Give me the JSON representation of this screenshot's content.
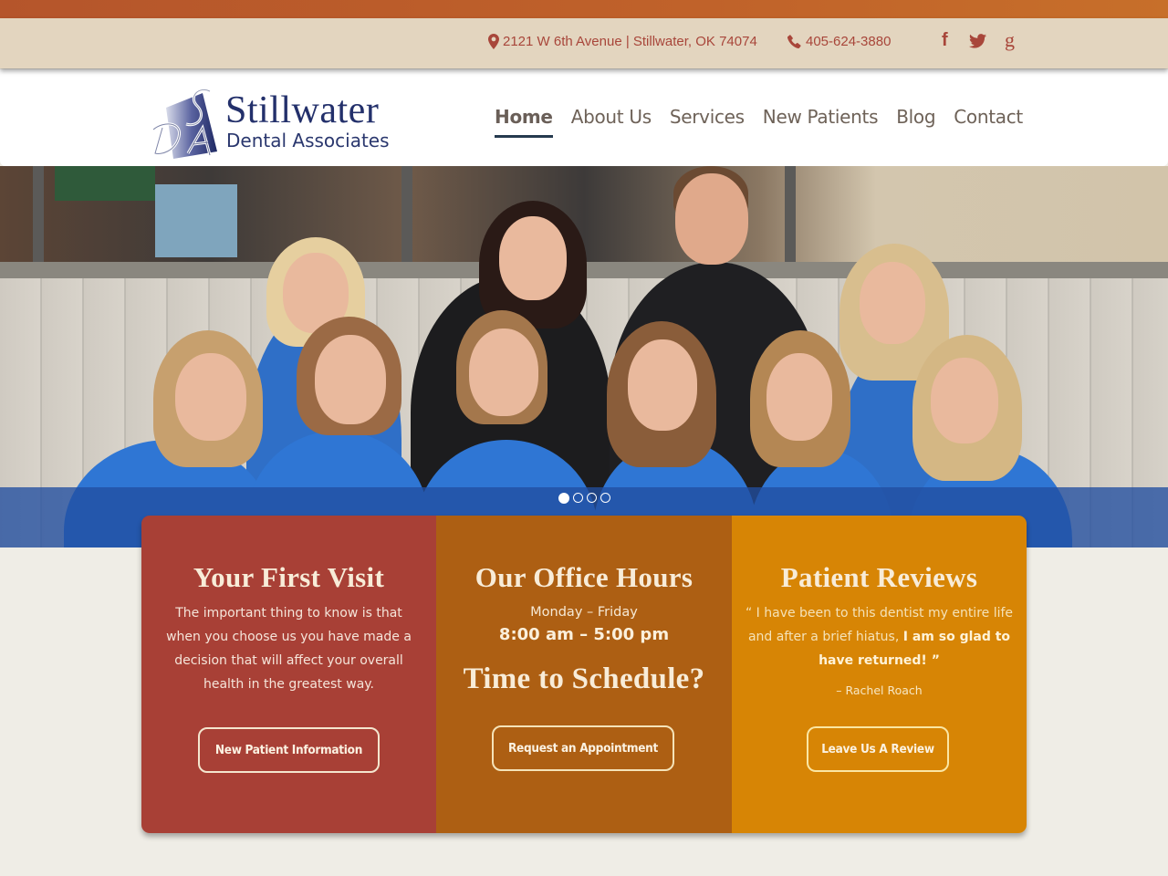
{
  "topbar": {
    "address": "2121 W 6th Avenue | Stillwater, OK 74074",
    "phone": "405-624-3880",
    "address_icon": "map-marker-icon",
    "phone_icon": "phone-icon",
    "social": [
      {
        "name": "facebook-icon",
        "glyph": "f"
      },
      {
        "name": "twitter-icon",
        "glyph": "🐦"
      },
      {
        "name": "google-plus-icon",
        "glyph": "g"
      }
    ]
  },
  "logo": {
    "line1": "Stillwater",
    "line2": "Dental Associates",
    "monogram": "SDA"
  },
  "nav": {
    "items": [
      {
        "label": "Home",
        "active": true
      },
      {
        "label": "About Us"
      },
      {
        "label": "Services"
      },
      {
        "label": "New Patients"
      },
      {
        "label": "Blog"
      },
      {
        "label": "Contact"
      }
    ]
  },
  "hero": {
    "slide_count": 4,
    "active_slide": 1,
    "image_alt": "Stillwater Dental Associates team photo"
  },
  "cards": {
    "first_visit": {
      "title": "Your First Visit",
      "body": "The important thing to know is that when you choose us you have made a decision that will affect your overall health in the greatest way.",
      "button": "New Patient Information"
    },
    "office_hours": {
      "title": "Our Office Hours",
      "days": "Monday – Friday",
      "hours": "8:00 am – 5:00 pm",
      "subtitle": "Time to Schedule?",
      "button": "Request an Appointment"
    },
    "reviews": {
      "title": "Patient Reviews",
      "quote_open": "“ I have been to this dentist my entire life and after a brief hiatus, ",
      "quote_bold": "I am so glad to have returned! ”",
      "author": "– Rachel Roach",
      "button": "Leave Us A Review"
    }
  },
  "colors": {
    "top_strip": "#b5552b",
    "info_bar": "#e3d5bf",
    "accent_text": "#a8463a",
    "logo_navy": "#23306b",
    "card_red": "#a84036",
    "card_brown": "#ad5f13",
    "card_orange": "#d78505",
    "hero_band": "#214ea0",
    "page_bg": "#efede6"
  }
}
